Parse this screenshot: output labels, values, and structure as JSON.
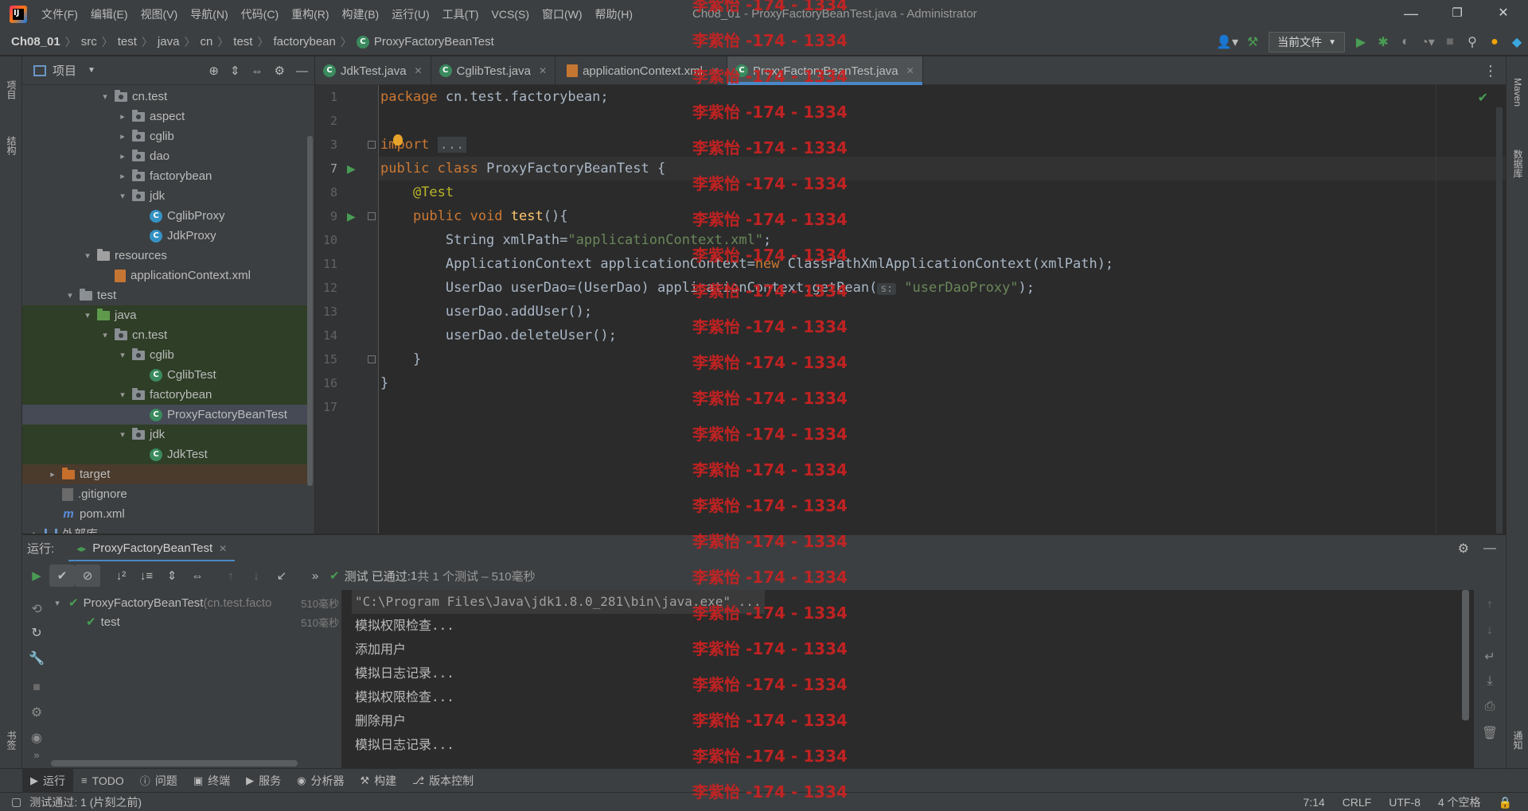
{
  "window": {
    "menu": [
      "文件(F)",
      "编辑(E)",
      "视图(V)",
      "导航(N)",
      "代码(C)",
      "重构(R)",
      "构建(B)",
      "运行(U)",
      "工具(T)",
      "VCS(S)",
      "窗口(W)",
      "帮助(H)"
    ],
    "title": "Ch08_01 - ProxyFactoryBeanTest.java - Administrator",
    "minimize": "—",
    "restore": "❐",
    "close": "✕"
  },
  "navbar": {
    "crumbs": [
      "Ch08_01",
      "src",
      "test",
      "java",
      "cn",
      "test",
      "factorybean",
      "ProxyFactoryBeanTest"
    ],
    "run_config": "当前文件"
  },
  "left_stripe": {
    "project": "项目",
    "structure": "结构",
    "bookmarks": "书签"
  },
  "right_stripe": {
    "maven": "Maven",
    "database": "数据库",
    "notifications": "通知"
  },
  "project_panel": {
    "title": "项目",
    "tree": [
      {
        "label": "cn.test",
        "indent": 5,
        "arrow": "▾",
        "icon": "pkg",
        "bg": ""
      },
      {
        "label": "aspect",
        "indent": 6,
        "arrow": "▸",
        "icon": "pkg",
        "bg": ""
      },
      {
        "label": "cglib",
        "indent": 6,
        "arrow": "▸",
        "icon": "pkg",
        "bg": ""
      },
      {
        "label": "dao",
        "indent": 6,
        "arrow": "▸",
        "icon": "pkg",
        "bg": ""
      },
      {
        "label": "factorybean",
        "indent": 6,
        "arrow": "▸",
        "icon": "pkg",
        "bg": ""
      },
      {
        "label": "jdk",
        "indent": 6,
        "arrow": "▾",
        "icon": "pkg",
        "bg": ""
      },
      {
        "label": "CglibProxy",
        "indent": 7,
        "arrow": "",
        "icon": "class",
        "bg": ""
      },
      {
        "label": "JdkProxy",
        "indent": 7,
        "arrow": "",
        "icon": "class",
        "bg": ""
      },
      {
        "label": "resources",
        "indent": 4,
        "arrow": "▾",
        "icon": "res",
        "bg": ""
      },
      {
        "label": "applicationContext.xml",
        "indent": 5,
        "arrow": "",
        "icon": "xml",
        "bg": ""
      },
      {
        "label": "test",
        "indent": 3,
        "arrow": "▾",
        "icon": "folder",
        "bg": ""
      },
      {
        "label": "java",
        "indent": 4,
        "arrow": "▾",
        "icon": "test",
        "bg": "green"
      },
      {
        "label": "cn.test",
        "indent": 5,
        "arrow": "▾",
        "icon": "pkg",
        "bg": "green"
      },
      {
        "label": "cglib",
        "indent": 6,
        "arrow": "▾",
        "icon": "pkg",
        "bg": "green"
      },
      {
        "label": "CglibTest",
        "indent": 7,
        "arrow": "",
        "icon": "testclass",
        "bg": "green"
      },
      {
        "label": "factorybean",
        "indent": 6,
        "arrow": "▾",
        "icon": "pkg",
        "bg": "green"
      },
      {
        "label": "ProxyFactoryBeanTest",
        "indent": 7,
        "arrow": "",
        "icon": "testclass",
        "bg": "sel"
      },
      {
        "label": "jdk",
        "indent": 6,
        "arrow": "▾",
        "icon": "pkg",
        "bg": "green"
      },
      {
        "label": "JdkTest",
        "indent": 7,
        "arrow": "",
        "icon": "testclass",
        "bg": "green"
      },
      {
        "label": "target",
        "indent": 2,
        "arrow": "▸",
        "icon": "excluded",
        "bg": "excl"
      },
      {
        "label": ".gitignore",
        "indent": 2,
        "arrow": "",
        "icon": "git",
        "bg": ""
      },
      {
        "label": "pom.xml",
        "indent": 2,
        "arrow": "",
        "icon": "maven",
        "bg": ""
      },
      {
        "label": "外部库",
        "indent": 1,
        "arrow": "▸",
        "icon": "lib",
        "bg": ""
      }
    ]
  },
  "editor": {
    "tabs": [
      {
        "label": "JdkTest.java",
        "icon": "testclass",
        "active": false
      },
      {
        "label": "CglibTest.java",
        "icon": "testclass",
        "active": false
      },
      {
        "label": "applicationContext.xml",
        "icon": "xml",
        "active": false
      },
      {
        "label": "ProxyFactoryBeanTest.java",
        "icon": "testclass",
        "active": true
      }
    ],
    "line_numbers": [
      "1",
      "2",
      "3",
      "7",
      "8",
      "9",
      "10",
      "11",
      "12",
      "13",
      "14",
      "15",
      "16",
      "17"
    ],
    "current_line": 3,
    "lines": [
      [
        [
          "k",
          "package "
        ],
        [
          "",
          "cn.test.factorybean;"
        ]
      ],
      [],
      [
        [
          "k",
          "import "
        ],
        [
          "fold",
          "..."
        ]
      ],
      [
        [
          "k",
          "public class "
        ],
        [
          "",
          "ProxyFactoryBeanTest {"
        ]
      ],
      [
        [
          "",
          "    "
        ],
        [
          "a",
          "@Test"
        ]
      ],
      [
        [
          "",
          "    "
        ],
        [
          "k",
          "public void "
        ],
        [
          "m",
          "test"
        ],
        [
          "",
          "(){"
        ]
      ],
      [
        [
          "",
          "        String xmlPath="
        ],
        [
          "s",
          "\"applicationContext.xml\""
        ],
        [
          "",
          ";"
        ]
      ],
      [
        [
          "",
          "        ApplicationContext applicationContext="
        ],
        [
          "k",
          "new "
        ],
        [
          "",
          "ClassPathXmlApplicationContext(xmlPath);"
        ]
      ],
      [
        [
          "",
          "        UserDao userDao=(UserDao) applicationContext.getBean("
        ],
        [
          "hint",
          "s:"
        ],
        [
          "",
          " "
        ],
        [
          "s",
          "\"userDaoProxy\""
        ],
        [
          "",
          ");"
        ]
      ],
      [
        [
          "",
          "        userDao.addUser();"
        ]
      ],
      [
        [
          "",
          "        userDao.deleteUser();"
        ]
      ],
      [
        [
          "",
          "    }"
        ]
      ],
      [
        [
          "",
          "}"
        ]
      ],
      []
    ]
  },
  "run_panel": {
    "label": "运行:",
    "tab": "ProxyFactoryBeanTest",
    "status": {
      "prefix": "测试 已通过: ",
      "count": "1",
      "detail": "共 1 个测试 – 510毫秒"
    },
    "tests": [
      {
        "name": "ProxyFactoryBeanTest",
        "pkg": " (cn.test.facto",
        "dur": "510毫秒",
        "indent": 0
      },
      {
        "name": "test",
        "pkg": "",
        "dur": "510毫秒",
        "indent": 1
      }
    ],
    "console": [
      "\"C:\\Program Files\\Java\\jdk1.8.0_281\\bin\\java.exe\" ...",
      "模拟权限检查...",
      "添加用户",
      "模拟日志记录...",
      "模拟权限检查...",
      "删除用户",
      "模拟日志记录..."
    ]
  },
  "toolwindows": [
    "运行",
    "TODO",
    "问题",
    "终端",
    "服务",
    "分析器",
    "构建",
    "版本控制"
  ],
  "statusbar": {
    "message": "测试通过: 1 (片刻之前)",
    "position": "7:14",
    "line_sep": "CRLF",
    "encoding": "UTF-8",
    "indent": "4 个空格"
  },
  "watermark": "李紫怡 -174 - 1334"
}
